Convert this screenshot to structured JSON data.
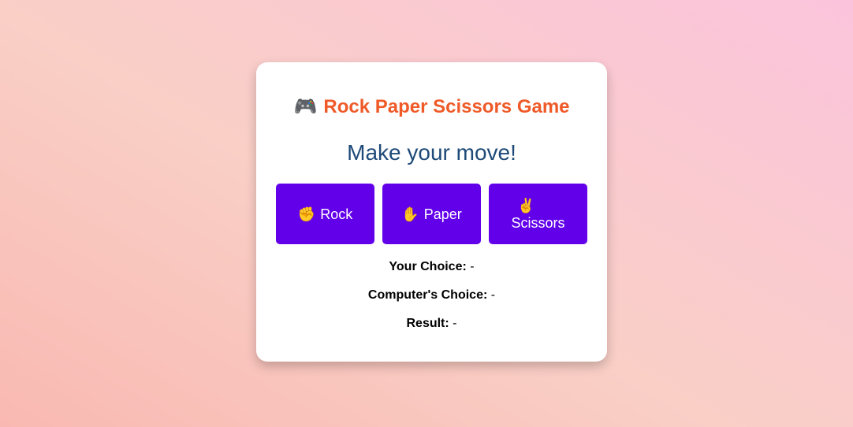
{
  "game": {
    "title": "Rock Paper Scissors Game",
    "title_icon": "🎮",
    "prompt": "Make your move!",
    "buttons": [
      {
        "emoji": "✊",
        "label": "Rock"
      },
      {
        "emoji": "✋",
        "label": "Paper"
      },
      {
        "emoji": "✌️",
        "label": "Scissors"
      }
    ],
    "your_choice_label": "Your Choice:",
    "your_choice_value": "-",
    "computer_choice_label": "Computer's Choice:",
    "computer_choice_value": "-",
    "result_label": "Result:",
    "result_value": "-"
  },
  "colors": {
    "title": "#ef5a28",
    "prompt": "#1d4a78",
    "button_bg": "#6200ea",
    "card_bg": "#ffffff"
  },
  "icons": {
    "title_icon": "game-controller-icon",
    "rock_icon": "raised-fist-icon",
    "paper_icon": "raised-hand-icon",
    "scissors_icon": "victory-hand-icon"
  }
}
